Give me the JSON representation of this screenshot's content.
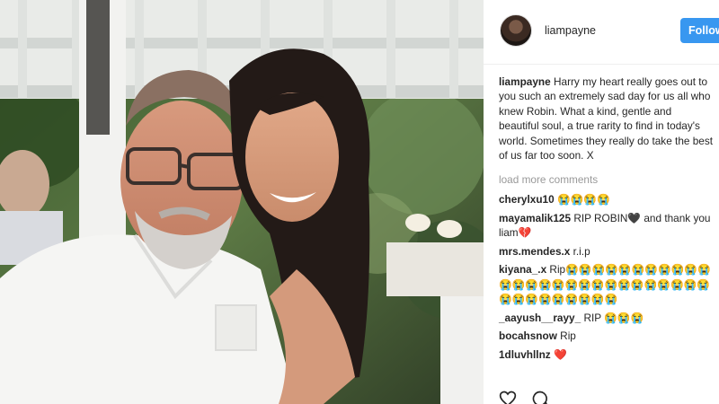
{
  "post": {
    "username": "liampayne",
    "follow_label": "Follow",
    "caption_user": "liampayne",
    "caption_text": "Harry my heart really goes out to you such an extremely sad day for us all who knew Robin. What a kind, gentle and beautiful soul, a true rarity to find in today's world. Sometimes they really do take the best of us far too soon. X",
    "load_more_label": "load more comments"
  },
  "comments": [
    {
      "user": "cherylxu10",
      "text": "😭😭😭😭"
    },
    {
      "user": "mayamalik125",
      "text": "RIP ROBIN🖤 and thank you liam💔"
    },
    {
      "user": "mrs.mendes.x",
      "text": "r.i.p"
    },
    {
      "user": "kiyana_.x",
      "text": "Rip😭😭😭😭😭😭😭😭😭😭😭😭😭😭😭😭😭😭😭😭😭😭😭😭😭😭😭😭😭😭😭😭😭😭😭😭"
    },
    {
      "user": "_aayush__rayy_",
      "text": "RIP 😭😭😭"
    },
    {
      "user": "bocahsnow",
      "text": "Rip"
    },
    {
      "user": "1dluvhllnz",
      "text": "❤️"
    }
  ],
  "actions": [
    {
      "icon": "heart-icon"
    },
    {
      "icon": "comment-icon"
    }
  ],
  "colors": {
    "follow_button": "#3897f0",
    "muted_text": "#999999",
    "text": "#262626"
  }
}
